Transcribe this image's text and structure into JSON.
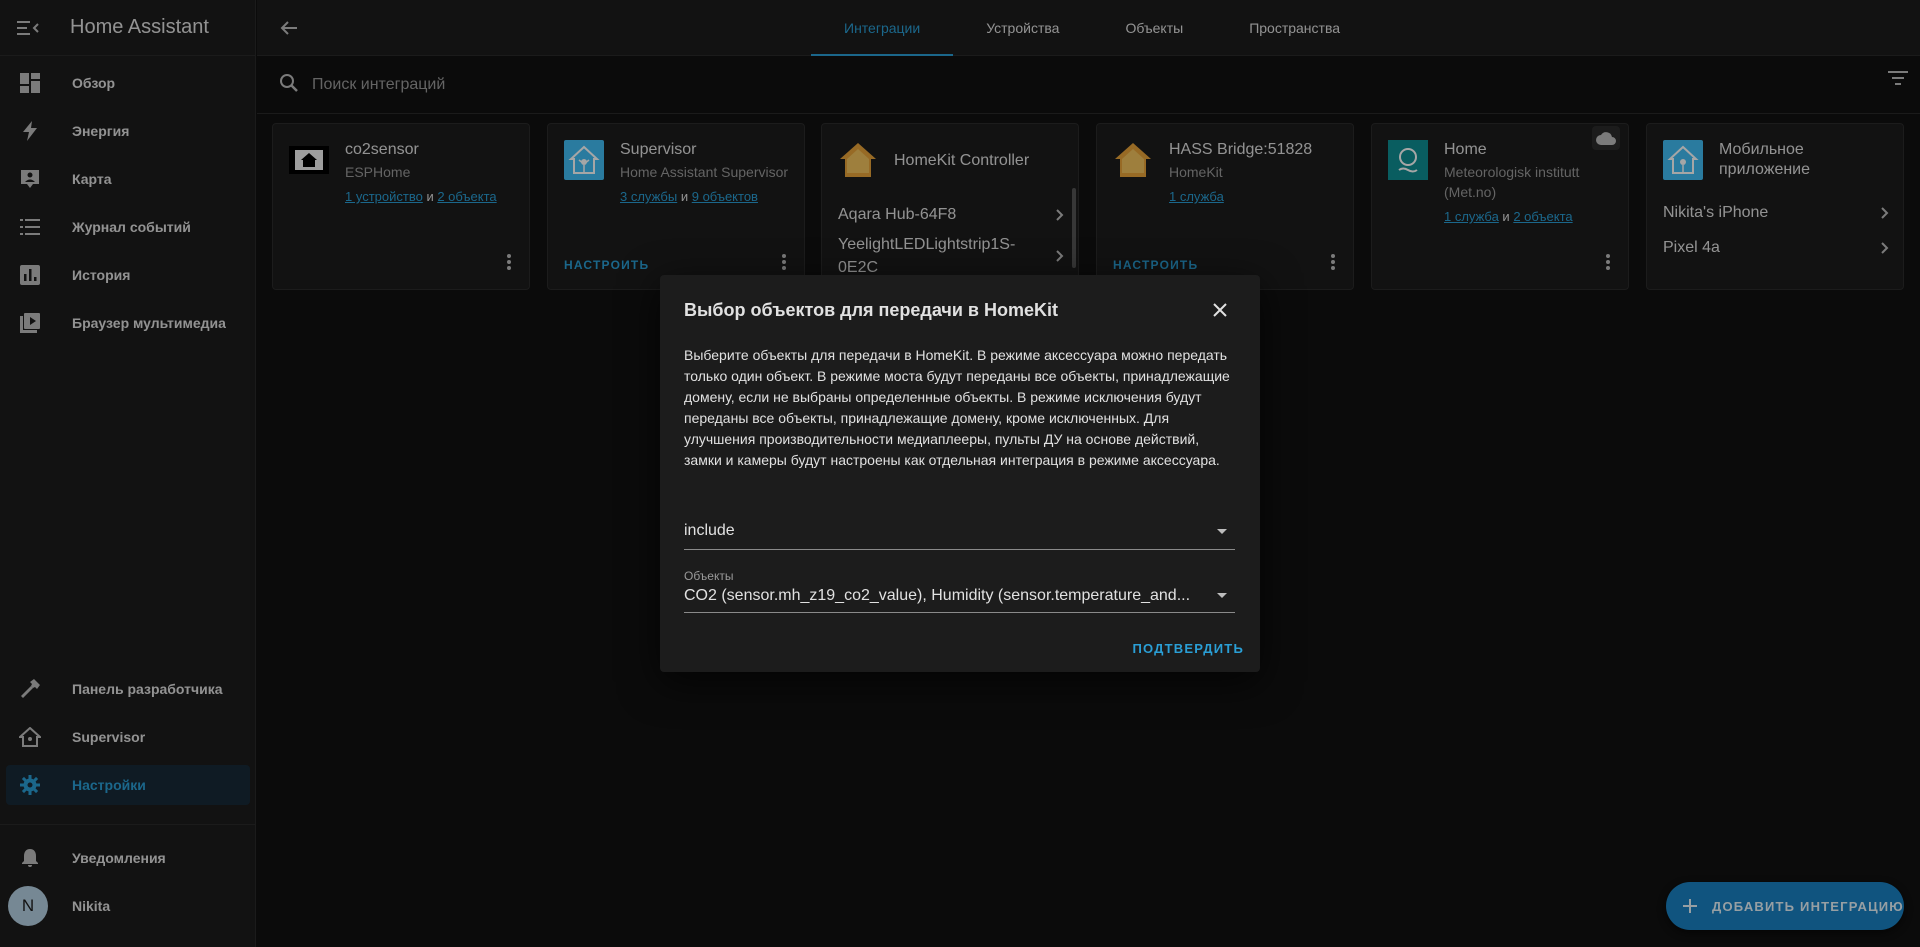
{
  "app": {
    "title": "Home Assistant"
  },
  "sidebar": {
    "items": [
      {
        "label": "Обзор",
        "icon": "dashboard-icon"
      },
      {
        "label": "Энергия",
        "icon": "lightning-icon"
      },
      {
        "label": "Карта",
        "icon": "map-account-icon"
      },
      {
        "label": "Журнал событий",
        "icon": "list-icon"
      },
      {
        "label": "История",
        "icon": "chart-box-icon"
      },
      {
        "label": "Браузер мультимедиа",
        "icon": "play-box-icon"
      }
    ],
    "bottom_items": [
      {
        "label": "Панель разработчика",
        "icon": "hammer-icon"
      },
      {
        "label": "Supervisor",
        "icon": "home-assistant-icon"
      },
      {
        "label": "Настройки",
        "icon": "cog-icon",
        "active": true
      }
    ],
    "notifications": {
      "label": "Уведомления"
    },
    "user": {
      "name": "Nikita",
      "initial": "N"
    }
  },
  "tabs": [
    "Интеграции",
    "Устройства",
    "Объекты",
    "Пространства"
  ],
  "search": {
    "placeholder": "Поиск интеграций"
  },
  "cards": [
    {
      "name": "co2sensor",
      "sub": "ESPHome",
      "link1": "1 устройство",
      "and": "и",
      "link2": "2 объекта"
    },
    {
      "name": "Supervisor",
      "sub": "Home Assistant Supervisor",
      "link1": "3 службы",
      "and": "и",
      "link2": "9 объектов",
      "configure": "НАСТРОИТЬ"
    },
    {
      "name": "HomeKit Controller",
      "rows": [
        "Aqara Hub-64F8",
        "YeelightLEDLightstrip1S-0E2C"
      ]
    },
    {
      "name": "HASS Bridge:51828",
      "sub": "HomeKit",
      "link1": "1 служба",
      "configure": "НАСТРОИТЬ"
    },
    {
      "name": "Home",
      "sub": "Meteorologisk institutt (Met.no)",
      "link1": "1 служба",
      "and": "и",
      "link2": "2 объекта"
    },
    {
      "name": "Мобильное приложение",
      "rows": [
        "Nikita's iPhone",
        "Pixel 4a"
      ]
    }
  ],
  "dialog": {
    "title": "Выбор объектов для передачи в HomeKit",
    "text": "Выберите объекты для передачи в HomeKit. В режиме аксессуара можно передать только один объект. В режиме моста будут переданы все объекты, принадлежащие домену, если не выбраны определенные объекты. В режиме исключения будут переданы все объекты, принадлежащие домену, кроме исключенных. Для улучшения производительности медиаплееры, пульты ДУ на основе действий, замки и камеры будут настроены как отдельная интеграция в режиме аксессуара.",
    "mode_value": "include",
    "entities_label": "Объекты",
    "entities_value": "CO2 (sensor.mh_z19_co2_value), Humidity (sensor.temperature_and...",
    "confirm": "ПОДТВЕРДИТЬ"
  },
  "fab": {
    "label": "ДОБАВИТЬ ИНТЕГРАЦИЮ"
  },
  "colors": {
    "accent": "#2a9fd6",
    "background": "#111111",
    "card": "#1c1c1c"
  }
}
